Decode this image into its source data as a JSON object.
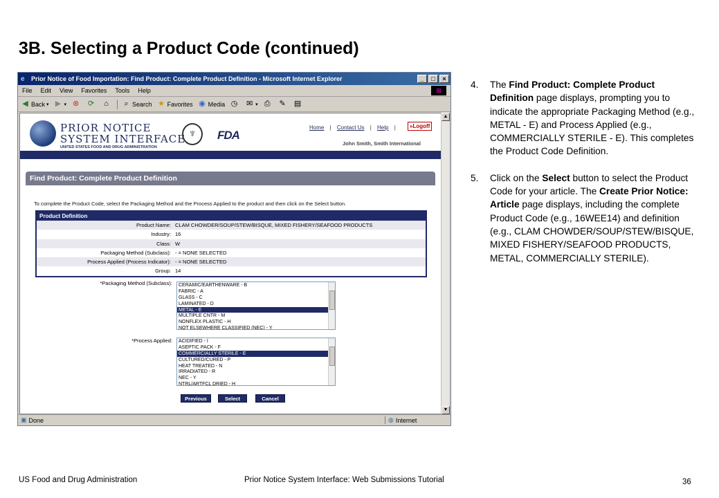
{
  "slide": {
    "title": "3B. Selecting a Product Code (continued)",
    "footer_left": "US Food and Drug Administration",
    "footer_center": "Prior Notice System Interface: Web Submissions Tutorial",
    "page_number": "36"
  },
  "browser": {
    "window_title": "Prior Notice of Food Importation: Find Product: Complete Product Definition - Microsoft Internet Explorer",
    "menu": [
      "File",
      "Edit",
      "View",
      "Favorites",
      "Tools",
      "Help"
    ],
    "toolbar": {
      "back": "Back",
      "search": "Search",
      "favorites": "Favorites",
      "media": "Media"
    },
    "status": {
      "left": "Done",
      "zone": "Internet"
    }
  },
  "page": {
    "logo_line1": "PRIOR NOTICE",
    "logo_line2": "SYSTEM INTERFACE",
    "logo_sub": "UNITED STATES FOOD AND DRUG ADMINISTRATION",
    "fda_logo": "FDA",
    "links": {
      "home": "Home",
      "contact": "Contact Us",
      "help": "Help",
      "sep": "|"
    },
    "logoff": "»Logoff",
    "user": "John Smith, Smith International",
    "section_title": "Find Product: Complete Product Definition",
    "instructions": "To complete the Product Code, select the Packaging Method and the Process Applied to the product and then click on the Select button.",
    "definition": {
      "header": "Product Definition",
      "rows": [
        {
          "k": "Product Name:",
          "v": "CLAM CHOWDER/SOUP/STEW/BISQUE, MIXED FISHERY/SEAFOOD PRODUCTS"
        },
        {
          "k": "Industry:",
          "v": "16"
        },
        {
          "k": "Class:",
          "v": "W"
        },
        {
          "k": "Packaging Method (Subclass):",
          "v": "- = NONE SELECTED"
        },
        {
          "k": "Process Applied (Process Indicator):",
          "v": "- = NONE SELECTED"
        },
        {
          "k": "Group:",
          "v": "14"
        }
      ]
    },
    "packaging": {
      "label": "*Packaging Method (Subclass):",
      "options": [
        "CERAMIC/EARTHENWARE - B",
        "FABRIC - A",
        "GLASS - C",
        "LAMINATED - D",
        "METAL - E",
        "MULTIPLE CNTR - M",
        "NONFLEX PLASTIC - H",
        "NOT ELSEWHERE CLASSIFIED (NEC) - Y"
      ],
      "selected_index": 4
    },
    "process": {
      "label": "*Process Applied:",
      "options": [
        "ACIDIFIED - I",
        "ASEPTIC PACK - F",
        "COMMERCIALLY STERILE - E",
        "CULTURED/CURED - P",
        "HEAT TREATED - N",
        "IRRADIATED - R",
        "NEC - Y",
        "NTRL/ARTFCL DRIED - H"
      ],
      "selected_index": 2
    },
    "buttons": {
      "previous": "Previous",
      "select": "Select",
      "cancel": "Cancel"
    }
  },
  "notes": [
    {
      "num": "4.",
      "parts": [
        {
          "t": "The "
        },
        {
          "t": "Find Product: Complete Product Definition",
          "b": true
        },
        {
          "t": " page displays, prompting you to indicate the appropriate Packaging Method (e.g., METAL - E) and Process Applied (e.g., COMMERCIALLY STERILE - E).  This completes the Product Code Definition."
        }
      ]
    },
    {
      "num": "5.",
      "parts": [
        {
          "t": "Click on the "
        },
        {
          "t": "Select",
          "b": true
        },
        {
          "t": " button to select the Product Code for your article.  The "
        },
        {
          "t": "Create Prior Notice: Article",
          "b": true
        },
        {
          "t": " page displays, including the complete Product Code (e.g., 16WEE14) and definition (e.g., CLAM CHOWDER/SOUP/STEW/BISQUE, MIXED FISHERY/SEAFOOD PRODUCTS, METAL, COMMERCIALLY STERILE)."
        }
      ]
    }
  ]
}
